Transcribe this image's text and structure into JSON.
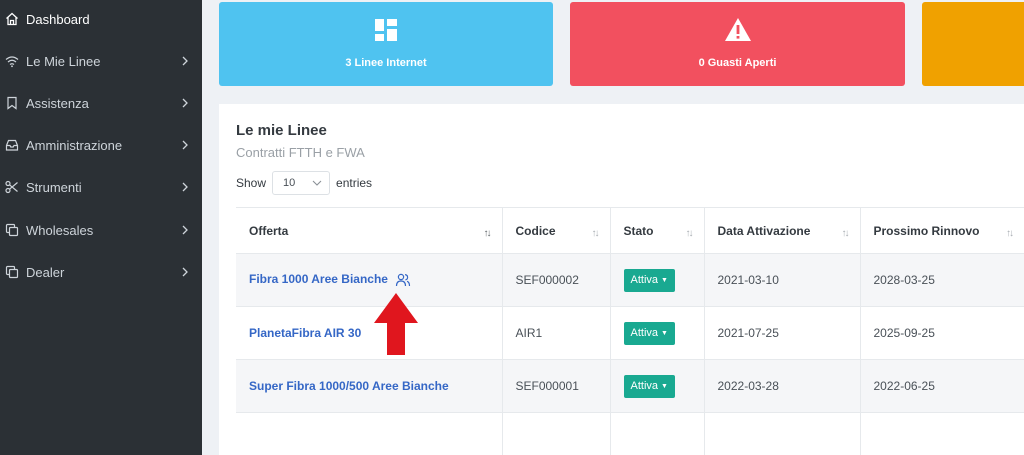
{
  "sidebar": {
    "items": [
      {
        "label": "Dashboard",
        "icon": "home-icon",
        "active": true
      },
      {
        "label": "Le Mie Linee",
        "icon": "wifi-icon"
      },
      {
        "label": "Assistenza",
        "icon": "bookmark-icon"
      },
      {
        "label": "Amministrazione",
        "icon": "inbox-icon"
      },
      {
        "label": "Strumenti",
        "icon": "scissors-icon"
      },
      {
        "label": "Wholesales",
        "icon": "copy-icon"
      },
      {
        "label": "Dealer",
        "icon": "copy-icon"
      }
    ]
  },
  "stats": [
    {
      "label": "3 Linee Internet",
      "icon": "grid-icon",
      "color": "#4fc3f0"
    },
    {
      "label": "0 Guasti Aperti",
      "icon": "warning-icon",
      "color": "#f2505f"
    },
    {
      "label": "",
      "color": "#f0a100"
    }
  ],
  "panel": {
    "title": "Le mie Linee",
    "subtitle": "Contratti FTTH e FWA",
    "show_label": "Show",
    "page_length": "10",
    "entries_label": "entries"
  },
  "table": {
    "columns": [
      "Offerta",
      "Codice",
      "Stato",
      "Data Attivazione",
      "Prossimo Rinnovo"
    ],
    "rows": [
      {
        "offerta": "Fibra 1000 Aree Bianche",
        "codice": "SEF000002",
        "stato": "Attiva",
        "attivazione": "2021-03-10",
        "rinnovo": "2028-03-25"
      },
      {
        "offerta": "PlanetaFibra AIR 30",
        "codice": "AIR1",
        "stato": "Attiva",
        "attivazione": "2021-07-25",
        "rinnovo": "2025-09-25"
      },
      {
        "offerta": "Super Fibra 1000/500 Aree Bianche",
        "codice": "SEF000001",
        "stato": "Attiva",
        "attivazione": "2022-03-28",
        "rinnovo": "2022-06-25"
      }
    ]
  },
  "colors": {
    "sidebar": "#2b3035",
    "badge": "#19a991",
    "link": "#3567c6",
    "arrow": "#e0161e"
  }
}
